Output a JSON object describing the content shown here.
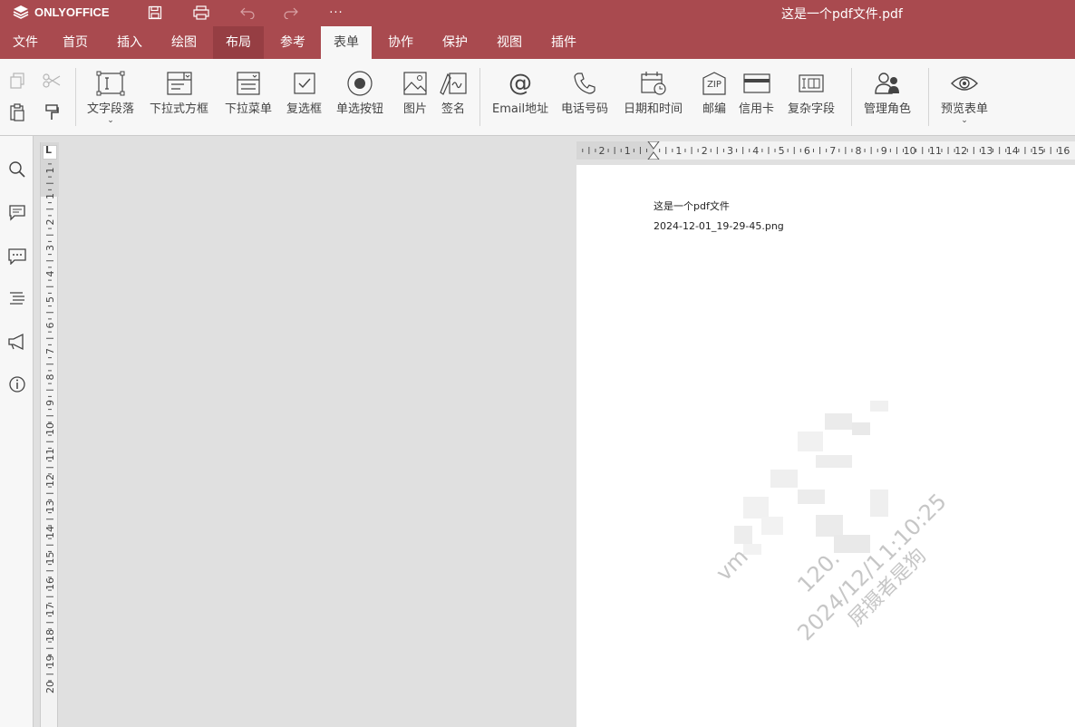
{
  "app": {
    "logo_text": "ONLYOFFICE",
    "doc_title": "这是一个pdf文件.pdf",
    "quick_more": "···"
  },
  "menu": {
    "tabs": [
      "文件",
      "首页",
      "插入",
      "绘图",
      "布局",
      "参考",
      "表单",
      "协作",
      "保护",
      "视图",
      "插件"
    ],
    "active_tab": "表单",
    "hover_tab": "布局"
  },
  "toolbar": {
    "buttons": [
      {
        "label": "文字段落",
        "icon": "text-field-icon",
        "dropdown": true
      },
      {
        "label": "下拉式方框",
        "icon": "combo-box-icon"
      },
      {
        "label": "下拉菜单",
        "icon": "dropdown-list-icon"
      },
      {
        "label": "复选框",
        "icon": "checkbox-icon"
      },
      {
        "label": "单选按钮",
        "icon": "radio-button-icon"
      },
      {
        "label": "图片",
        "icon": "image-icon"
      },
      {
        "label": "签名",
        "icon": "signature-icon"
      },
      {
        "label": "Email地址",
        "icon": "email-icon"
      },
      {
        "label": "电话号码",
        "icon": "phone-icon"
      },
      {
        "label": "日期和时间",
        "icon": "calendar-icon"
      },
      {
        "label": "邮编",
        "icon": "zip-icon",
        "icon_text": "ZIP"
      },
      {
        "label": "信用卡",
        "icon": "credit-card-icon"
      },
      {
        "label": "复杂字段",
        "icon": "complex-field-icon"
      },
      {
        "label": "管理角色",
        "icon": "manage-roles-icon"
      },
      {
        "label": "预览表单",
        "icon": "eye-icon",
        "dropdown": true
      }
    ]
  },
  "ruler": {
    "h_labels": [
      "2",
      "1",
      "",
      "1",
      "2",
      "3",
      "4",
      "5",
      "6",
      "7",
      "8",
      "9",
      "10",
      "11",
      "12",
      "13",
      "14",
      "15",
      "16"
    ],
    "v_labels": [
      "1",
      "1",
      "2",
      "3",
      "4",
      "5",
      "6",
      "7",
      "8",
      "9",
      "10",
      "11",
      "12",
      "13",
      "14",
      "15",
      "16",
      "17",
      "18",
      "19",
      "20"
    ],
    "corner": "L"
  },
  "document": {
    "line1": "这是一个pdf文件",
    "line2": "2024-12-01_19-29-45.png"
  },
  "watermark": {
    "lines": [
      "vm",
      "120.",
      "2024/12/1",
      "1:10:25",
      "屏摄者是狗"
    ]
  },
  "colors": {
    "brand": "#a94a4f",
    "toolbar_bg": "#f7f7f7",
    "workspace": "#e0e0e0"
  }
}
